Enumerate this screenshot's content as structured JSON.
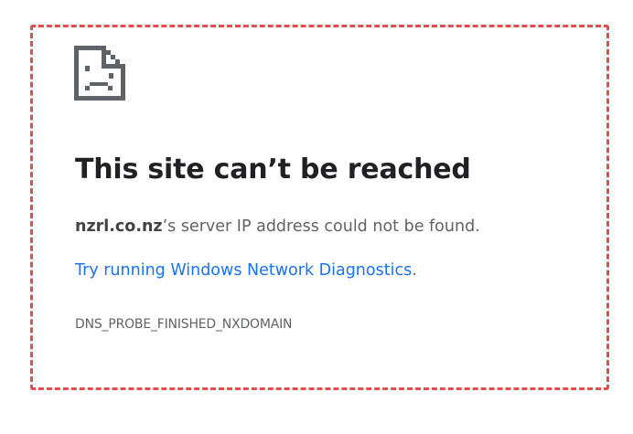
{
  "error_page": {
    "icon": "sad-file-icon",
    "title": "This site can’t be reached",
    "message": {
      "domain": "nzrl.co.nz",
      "suffix": "’s server IP address could not be found."
    },
    "diagnostics": {
      "link_text": "Try running Windows Network Diagnostics",
      "trailing": "."
    },
    "error_code": "DNS_PROBE_FINISHED_NXDOMAIN"
  },
  "colors": {
    "frame_border": "#e04f50",
    "title": "#202124",
    "body_text": "#5f6368",
    "link": "#1a73e8",
    "icon": "#5f6368"
  }
}
